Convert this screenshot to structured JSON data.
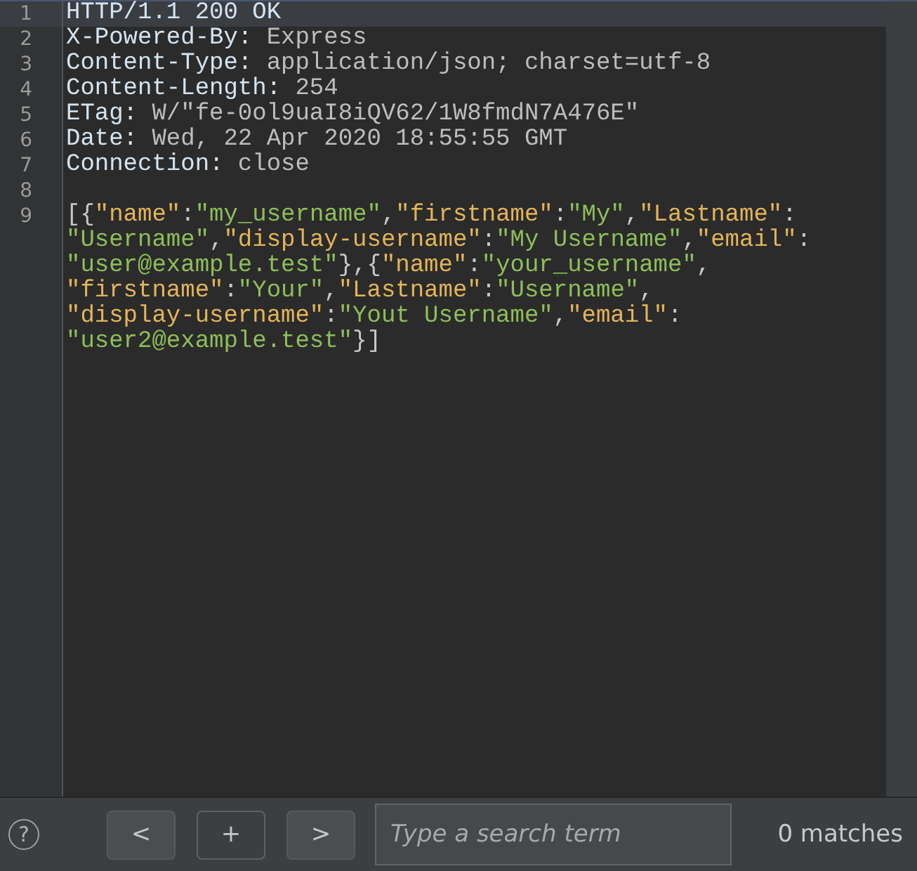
{
  "editor": {
    "lines": [
      {
        "number": "1",
        "current": true,
        "segments": [
          {
            "tokens": [
              {
                "text": "HTTP/1.1 200 OK",
                "kind": "name"
              }
            ]
          }
        ]
      },
      {
        "number": "2",
        "current": false,
        "segments": [
          {
            "tokens": [
              {
                "text": "X-Powered-By:",
                "kind": "name"
              },
              {
                "text": " Express",
                "kind": "value"
              }
            ]
          }
        ]
      },
      {
        "number": "3",
        "current": false,
        "segments": [
          {
            "tokens": [
              {
                "text": "Content-Type:",
                "kind": "name"
              },
              {
                "text": " application/json; charset=utf-8",
                "kind": "value"
              }
            ]
          }
        ]
      },
      {
        "number": "4",
        "current": false,
        "segments": [
          {
            "tokens": [
              {
                "text": "Content-Length:",
                "kind": "name"
              },
              {
                "text": " 254",
                "kind": "value"
              }
            ]
          }
        ]
      },
      {
        "number": "5",
        "current": false,
        "segments": [
          {
            "tokens": [
              {
                "text": "ETag:",
                "kind": "name"
              },
              {
                "text": " W/\"fe-0ol9uaI8iQV62/1W8fmdN7A476E\"",
                "kind": "value"
              }
            ]
          }
        ]
      },
      {
        "number": "6",
        "current": false,
        "segments": [
          {
            "tokens": [
              {
                "text": "Date:",
                "kind": "name"
              },
              {
                "text": " Wed, 22 Apr 2020 18:55:55 GMT",
                "kind": "value"
              }
            ]
          }
        ]
      },
      {
        "number": "7",
        "current": false,
        "segments": [
          {
            "tokens": [
              {
                "text": "Connection:",
                "kind": "name"
              },
              {
                "text": " close",
                "kind": "value"
              }
            ]
          }
        ]
      },
      {
        "number": "8",
        "current": false
      },
      {
        "number": "9",
        "current": false,
        "segments": [
          {
            "tokens": [
              {
                "text": "[{",
                "kind": "punct"
              },
              {
                "text": "\"name\"",
                "kind": "key"
              },
              {
                "text": ":",
                "kind": "punct"
              },
              {
                "text": "\"my_username\"",
                "kind": "string"
              },
              {
                "text": ",",
                "kind": "punct"
              },
              {
                "text": "\"firstname\"",
                "kind": "key"
              },
              {
                "text": ":",
                "kind": "punct"
              },
              {
                "text": "\"My\"",
                "kind": "string"
              },
              {
                "text": ",",
                "kind": "punct"
              },
              {
                "text": "\"Lastname\"",
                "kind": "key"
              },
              {
                "text": ":",
                "kind": "punct"
              }
            ]
          },
          {
            "tokens": [
              {
                "text": "\"Username\"",
                "kind": "string"
              },
              {
                "text": ",",
                "kind": "punct"
              },
              {
                "text": "\"display-username\"",
                "kind": "key"
              },
              {
                "text": ":",
                "kind": "punct"
              },
              {
                "text": "\"My Username\"",
                "kind": "string"
              },
              {
                "text": ",",
                "kind": "punct"
              },
              {
                "text": "\"email\"",
                "kind": "key"
              },
              {
                "text": ":",
                "kind": "punct"
              }
            ]
          },
          {
            "tokens": [
              {
                "text": "\"user@example.test\"",
                "kind": "string"
              },
              {
                "text": "},{",
                "kind": "punct"
              },
              {
                "text": "\"name\"",
                "kind": "key"
              },
              {
                "text": ":",
                "kind": "punct"
              },
              {
                "text": "\"your_username\"",
                "kind": "string"
              },
              {
                "text": ",",
                "kind": "punct"
              }
            ]
          },
          {
            "tokens": [
              {
                "text": "\"firstname\"",
                "kind": "key"
              },
              {
                "text": ":",
                "kind": "punct"
              },
              {
                "text": "\"Your\"",
                "kind": "string"
              },
              {
                "text": ",",
                "kind": "punct"
              },
              {
                "text": "\"Lastname\"",
                "kind": "key"
              },
              {
                "text": ":",
                "kind": "punct"
              },
              {
                "text": "\"Username\"",
                "kind": "string"
              },
              {
                "text": ",",
                "kind": "punct"
              }
            ]
          },
          {
            "tokens": [
              {
                "text": "\"display-username\"",
                "kind": "key"
              },
              {
                "text": ":",
                "kind": "punct"
              },
              {
                "text": "\"Yout Username\"",
                "kind": "string"
              },
              {
                "text": ",",
                "kind": "punct"
              },
              {
                "text": "\"email\"",
                "kind": "key"
              },
              {
                "text": ":",
                "kind": "punct"
              }
            ]
          },
          {
            "tokens": [
              {
                "text": "\"user2@example.test\"",
                "kind": "string"
              },
              {
                "text": "}]",
                "kind": "punct"
              }
            ]
          }
        ]
      }
    ]
  },
  "search_bar": {
    "help": "?",
    "buttons": [
      {
        "label": "<",
        "kind": "nav"
      },
      {
        "label": "+",
        "kind": "toggle"
      },
      {
        "label": ">",
        "kind": "nav"
      }
    ],
    "search": {
      "placeholder": "Type a search term"
    },
    "matches": "0 matches"
  }
}
